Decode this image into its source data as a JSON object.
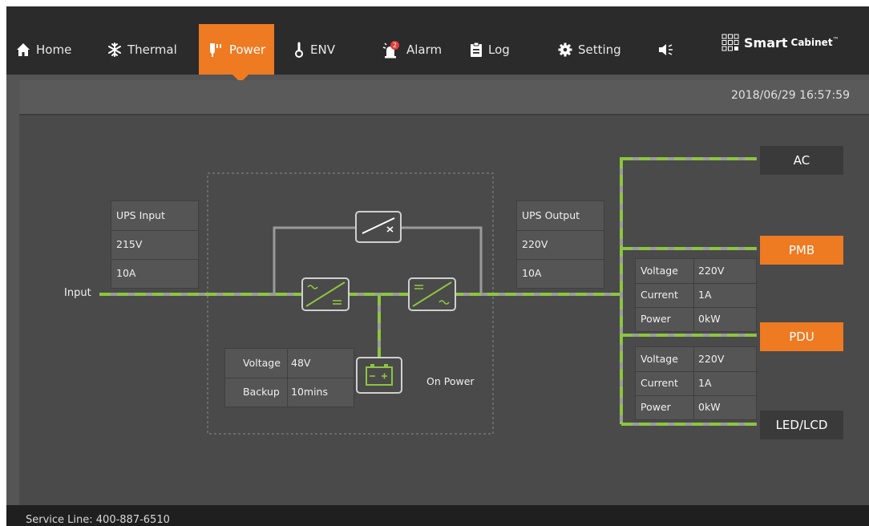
{
  "nav": {
    "items": [
      {
        "label": "Home",
        "icon": "home-icon"
      },
      {
        "label": "Thermal",
        "icon": "snowflake-icon"
      },
      {
        "label": "Power",
        "icon": "power-plug-icon",
        "active": true
      },
      {
        "label": "ENV",
        "icon": "thermometer-icon"
      },
      {
        "label": "Alarm",
        "icon": "alarm-siren-icon",
        "badge": "2"
      },
      {
        "label": "Log",
        "icon": "clipboard-icon"
      },
      {
        "label": "Setting",
        "icon": "gear-icon"
      }
    ],
    "speaker_icon": "speaker-icon",
    "brand": {
      "word1": "Smart",
      "word2": "Cabinet",
      "tm": "™"
    }
  },
  "datetime": "2018/06/29 16:57:59",
  "diagram": {
    "input_label": "Input",
    "ups_input": {
      "title": "UPS Input",
      "voltage": "215V",
      "current": "10A"
    },
    "ups_output": {
      "title": "UPS Output",
      "voltage": "220V",
      "current": "10A"
    },
    "battery": {
      "voltage_label": "Voltage",
      "voltage_value": "48V",
      "backup_label": "Backup",
      "backup_value": "10mins",
      "status": "On Power"
    },
    "outputs": {
      "ac": "AC",
      "pmb": {
        "label": "PMB",
        "voltage_label": "Voltage",
        "voltage": "220V",
        "current_label": "Current",
        "current": "1A",
        "power_label": "Power",
        "power": "0kW"
      },
      "pdu": {
        "label": "PDU",
        "voltage_label": "Voltage",
        "voltage": "220V",
        "current_label": "Current",
        "current": "1A",
        "power_label": "Power",
        "power": "0kW"
      },
      "led": "LED/LCD"
    }
  },
  "footer": {
    "service_line": "Service Line: 400-887-6510"
  },
  "colors": {
    "accent": "#ee7a22",
    "line_green": "#8cc63f",
    "line_gray": "#9a9a9a",
    "nav_bg": "#2b2b2b"
  }
}
